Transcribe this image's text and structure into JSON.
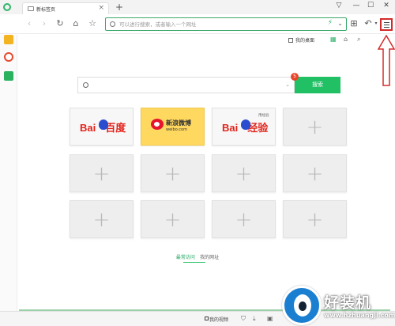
{
  "titlebar": {
    "tab_title": "新标签页",
    "tab_close": "×",
    "new_tab": "+",
    "controls": [
      "▽",
      "—",
      "☐",
      "✕"
    ]
  },
  "nav": {
    "back": "‹",
    "forward": "›",
    "reload": "↻",
    "home": "⌂",
    "favorite": "☆"
  },
  "address_bar": {
    "value": "",
    "placeholder": "可以进行搜索，或者输入一个网址",
    "bolt": "⚡",
    "dropdown": "⌄"
  },
  "toolbar": {
    "apps_icon": "⊞",
    "undo_icon": "↶",
    "undo_more": "▾",
    "menu_icon": "hamburger-menu"
  },
  "subbar": {
    "my_desktop": "我的桌面",
    "icons": [
      "grid-icon",
      "home-icon",
      "search-icon",
      "settings-icon"
    ]
  },
  "search": {
    "value": "",
    "button": "搜索",
    "badge_count": "5",
    "dropdown": "⌄"
  },
  "tiles": [
    {
      "type": "baidu"
    },
    {
      "type": "weibo",
      "title": "新浪微博",
      "sub": "weibo.com"
    },
    {
      "type": "baidu-jingyan",
      "tag": "用经验",
      "brand": "经验"
    },
    {
      "type": "add"
    },
    {
      "type": "add"
    },
    {
      "type": "add"
    },
    {
      "type": "add"
    },
    {
      "type": "add"
    },
    {
      "type": "add"
    },
    {
      "type": "add"
    },
    {
      "type": "add"
    },
    {
      "type": "add"
    }
  ],
  "logos": {
    "bai": "Bai",
    "du": "百度"
  },
  "bottom_links": {
    "frequent": "最常访问",
    "my_sites": "我的网址"
  },
  "statusbar": {
    "video": "我的视频"
  },
  "watermark": {
    "text": "好装机",
    "url": "www.hzhuangji.com"
  },
  "colors": {
    "accent_green": "#22c065",
    "annotation_red": "#d32b2b",
    "badge_red": "#e8442a",
    "baidu_red": "#e2231a",
    "baidu_blue": "#2a4dcf"
  }
}
